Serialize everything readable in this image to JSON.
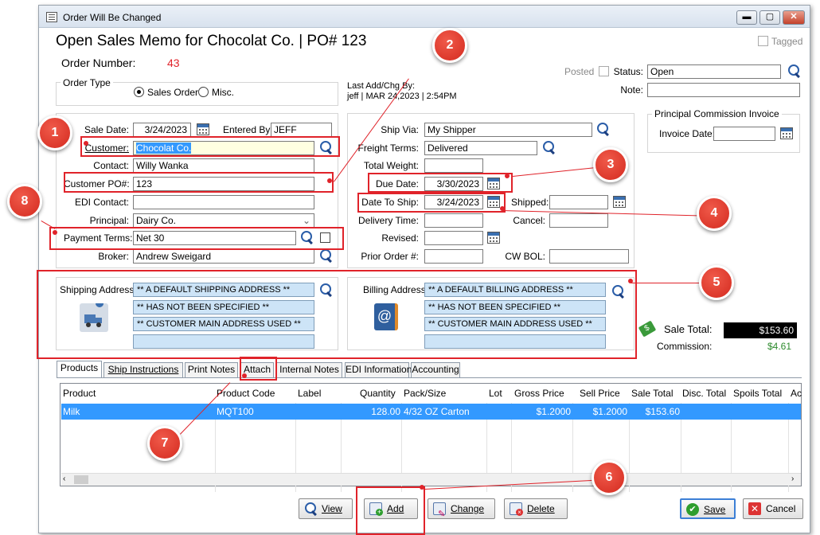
{
  "window": {
    "title": "Order Will Be Changed"
  },
  "header": {
    "title": "Open Sales Memo for Chocolat Co. | PO# 123",
    "tagged_label": "Tagged",
    "order_number_label": "Order Number:",
    "order_number": "43",
    "posted_label": "Posted",
    "status_label": "Status:",
    "status_value": "Open",
    "note_label": "Note:",
    "note_value": ""
  },
  "order_type": {
    "label": "Order Type",
    "sales_order": "Sales Order",
    "misc": "Misc.",
    "selected": "Sales Order"
  },
  "last_add": {
    "label": "Last Add/Chg By:",
    "value": "jeff | MAR 24,2023 |  2:54PM"
  },
  "left_form": {
    "sale_date_label": "Sale Date:",
    "sale_date": "3/24/2023",
    "entered_by_label": "Entered By:",
    "entered_by": "JEFF",
    "customer_label": "Customer:",
    "customer": "Chocolat Co.",
    "contact_label": "Contact:",
    "contact": "Willy Wanka",
    "customer_po_label": "Customer PO#:",
    "customer_po": "123",
    "edi_contact_label": "EDI Contact:",
    "edi_contact": "",
    "principal_label": "Principal:",
    "principal": "Dairy Co.",
    "payment_terms_label": "Payment Terms:",
    "payment_terms": "Net 30",
    "broker_label": "Broker:",
    "broker": "Andrew Sweigard"
  },
  "right_form": {
    "ship_via_label": "Ship Via:",
    "ship_via": "My Shipper",
    "freight_terms_label": "Freight Terms:",
    "freight_terms": "Delivered",
    "total_weight_label": "Total Weight:",
    "total_weight": "",
    "due_date_label": "Due Date:",
    "due_date": "3/30/2023",
    "date_to_ship_label": "Date To Ship:",
    "date_to_ship": "3/24/2023",
    "shipped_label": "Shipped:",
    "shipped": "",
    "delivery_time_label": "Delivery Time:",
    "delivery_time": "",
    "cancel_label": "Cancel:",
    "cancel": "",
    "revised_label": "Revised:",
    "revised": "",
    "prior_order_label": "Prior Order #:",
    "prior_order": "",
    "cw_bol_label": "CW BOL:",
    "cw_bol": ""
  },
  "commission_invoice": {
    "group_label": "Principal Commission Invoice",
    "invoice_date_label": "Invoice Date:",
    "invoice_date": ""
  },
  "shipping": {
    "label": "Shipping Address:",
    "lines": [
      "** A DEFAULT SHIPPING ADDRESS **",
      "** HAS NOT BEEN SPECIFIED **",
      "** CUSTOMER MAIN ADDRESS USED **",
      ""
    ]
  },
  "billing": {
    "label": "Billing Address:",
    "lines": [
      "** A DEFAULT BILLING ADDRESS **",
      "** HAS NOT BEEN SPECIFIED **",
      "** CUSTOMER MAIN ADDRESS USED **",
      ""
    ]
  },
  "totals": {
    "sale_total_label": "Sale Total:",
    "sale_total": "$153.60",
    "commission_label": "Commission:",
    "commission": "$4.61"
  },
  "tabs": [
    "Products",
    "Ship Instructions",
    "Print Notes",
    "Attach",
    "Internal Notes",
    "EDI Information",
    "Accounting"
  ],
  "grid": {
    "columns": [
      "Product",
      "Product Code",
      "Label",
      "Quantity",
      "Pack/Size",
      "Lot",
      "Gross Price",
      "Sell Price",
      "Sale Total",
      "Disc. Total",
      "Spoils Total",
      "Ac"
    ],
    "rows": [
      {
        "product": "Milk",
        "code": "MQT100",
        "label": "",
        "quantity": "128.00",
        "pack": "4/32  OZ Carton",
        "lot": "",
        "gross": "$1.2000",
        "sell": "$1.2000",
        "sale_total": "$153.60",
        "disc": "",
        "spoils": ""
      }
    ]
  },
  "buttons": {
    "view": "View",
    "add": "Add",
    "change": "Change",
    "delete": "Delete",
    "save": "Save",
    "cancel": "Cancel"
  },
  "callouts": [
    "1",
    "2",
    "3",
    "4",
    "5",
    "6",
    "7",
    "8"
  ],
  "colors": {
    "callout": "#e0232a",
    "selection": "#3399ff",
    "order_number": "#e0232a",
    "commission": "#2e8b2e"
  }
}
